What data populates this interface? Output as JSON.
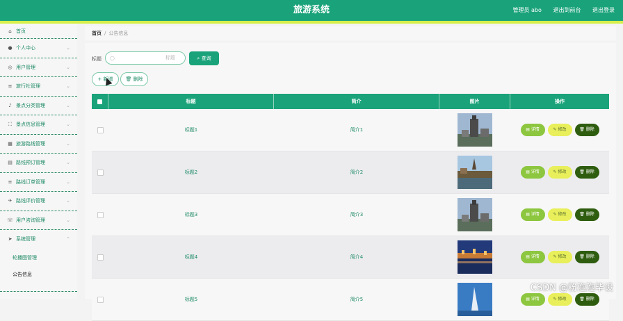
{
  "header": {
    "title": "旅游系统",
    "user": "管理员 abo",
    "goto_front": "退出到前台",
    "logout": "退出登录"
  },
  "sidebar": {
    "home": {
      "label": "首页",
      "icon": "home-icon"
    },
    "items": [
      {
        "label": "个人中心",
        "icon": "user-icon"
      },
      {
        "label": "用户管理",
        "icon": "users-icon"
      },
      {
        "label": "旅行社管理",
        "icon": "list-icon"
      },
      {
        "label": "景点分类管理",
        "icon": "mic-icon"
      },
      {
        "label": "景点信息管理",
        "icon": "frame-icon"
      },
      {
        "label": "旅游路线管理",
        "icon": "grid-icon"
      },
      {
        "label": "路线预订管理",
        "icon": "document-icon"
      },
      {
        "label": "路线订单管理",
        "icon": "list-icon"
      },
      {
        "label": "路线评价管理",
        "icon": "plane-icon"
      },
      {
        "label": "用户咨询管理",
        "icon": "chat-icon"
      },
      {
        "label": "系统管理",
        "icon": "send-icon",
        "expanded": true
      }
    ],
    "sub_items": [
      {
        "label": "轮播图管理"
      },
      {
        "label": "公告信息",
        "active": true
      }
    ]
  },
  "breadcrumb": {
    "home": "首页",
    "separator": "/",
    "current": "公告信息"
  },
  "search": {
    "label": "标题",
    "placeholder": "标题",
    "query_button": "查询"
  },
  "actions": {
    "add": "新增",
    "delete": "删除"
  },
  "table": {
    "headers": [
      "标题",
      "简介",
      "图片",
      "操作"
    ],
    "rows": [
      {
        "title": "标题1",
        "intro": "简介1",
        "image": "tower-photo"
      },
      {
        "title": "标题2",
        "intro": "简介2",
        "image": "lake-church-photo"
      },
      {
        "title": "标题3",
        "intro": "简介3",
        "image": "tower-photo"
      },
      {
        "title": "标题4",
        "intro": "简介4",
        "image": "night-harbor-photo"
      },
      {
        "title": "标题5",
        "intro": "简介5",
        "image": "sail-hotel-photo"
      }
    ],
    "op_labels": {
      "view": "详情",
      "edit": "修改",
      "remove": "删除"
    }
  },
  "watermark": "CSDN @粉泡泡毕设",
  "colors": {
    "primary": "#1aa37a",
    "accent_stripe": "#d7ef4c",
    "view": "#8dc63f",
    "edit": "#e8ef5a",
    "remove": "#2f5d0f"
  }
}
